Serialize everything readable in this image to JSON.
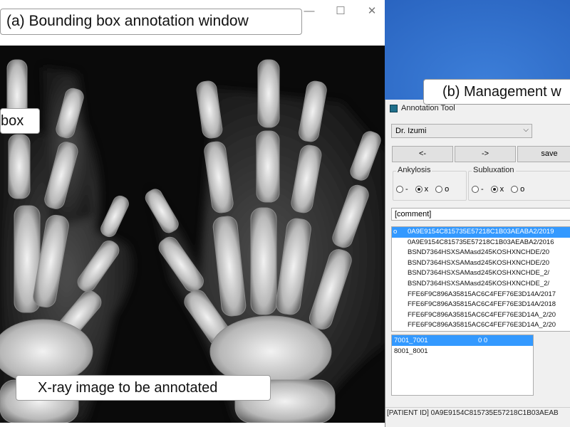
{
  "callouts": {
    "window_a": "(a) Bounding box annotation window",
    "box": "box",
    "xray": "X-ray image to be annotated",
    "window_b": "(b) Management w"
  },
  "window_a": {
    "controls": {
      "minimize": "—",
      "maximize": "☐",
      "close": "✕"
    }
  },
  "window_b": {
    "title": "Annotation Tool",
    "doctor": "Dr. Izumi",
    "buttons": {
      "prev": "<-",
      "next": "->",
      "save": "save"
    },
    "ankylosis": {
      "label": "Ankylosis",
      "options": [
        "-",
        "x",
        "o"
      ],
      "selected": "x"
    },
    "subluxation": {
      "label": "Subluxation",
      "options": [
        "-",
        "x",
        "o"
      ],
      "selected": "x"
    },
    "comment": "[comment]",
    "files": [
      {
        "mark": "o",
        "name": "0A9E9154C815735E57218C1B03AEABA2/2019",
        "selected": true
      },
      {
        "mark": "",
        "name": "0A9E9154C815735E57218C1B03AEABA2/2016",
        "selected": false
      },
      {
        "mark": "",
        "name": "BSND7364HSXSAMasd245KOSHXNCHDE/20",
        "selected": false
      },
      {
        "mark": "",
        "name": "BSND7364HSXSAMasd245KOSHXNCHDE/20",
        "selected": false
      },
      {
        "mark": "",
        "name": "BSND7364HSXSAMasd245KOSHXNCHDE_2/",
        "selected": false
      },
      {
        "mark": "",
        "name": "BSND7364HSXSAMasd245KOSHXNCHDE_2/",
        "selected": false
      },
      {
        "mark": "",
        "name": "FFE6F9C896A35815AC6C4FEF76E3D14A/2017",
        "selected": false
      },
      {
        "mark": "",
        "name": "FFE6F9C896A35815AC6C4FEF76E3D14A/2018",
        "selected": false
      },
      {
        "mark": "",
        "name": "FFE6F9C896A35815AC6C4FEF76E3D14A_2/20",
        "selected": false
      },
      {
        "mark": "",
        "name": "FFE6F9C896A35815AC6C4FEF76E3D14A_2/20",
        "selected": false
      }
    ],
    "bboxes": [
      {
        "id": "7001_7001",
        "value": "0 0",
        "selected": true
      },
      {
        "id": "8001_8001",
        "value": "",
        "selected": false
      }
    ],
    "status": "[PATIENT ID] 0A9E9154C815735E57218C1B03AEAB"
  }
}
